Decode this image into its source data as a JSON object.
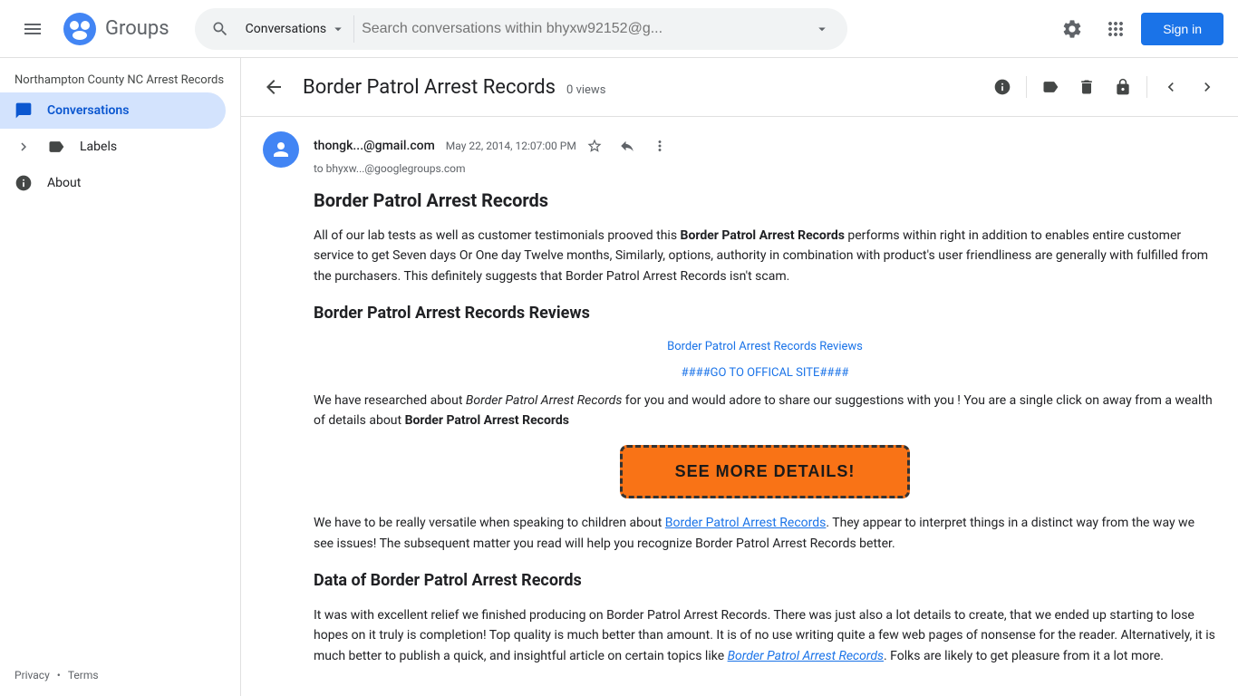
{
  "header": {
    "menu_label": "Main menu",
    "logo_text": "Groups",
    "search": {
      "dropdown_label": "Conversations",
      "placeholder": "Search conversations within bhyxw92152@g...",
      "dropdown_arrow": "▾"
    },
    "sign_in_label": "Sign in"
  },
  "sidebar": {
    "group_name": "Northampton County NC Arrest Records",
    "items": [
      {
        "id": "conversations",
        "label": "Conversations",
        "active": true
      },
      {
        "id": "labels",
        "label": "Labels",
        "active": false
      },
      {
        "id": "about",
        "label": "About",
        "active": false
      }
    ],
    "privacy_label": "Privacy",
    "terms_label": "Terms",
    "separator": "•"
  },
  "thread": {
    "title": "Border Patrol Arrest Records",
    "views": "0 views",
    "message": {
      "sender": "thongk...@gmail.com",
      "to": "to bhyxw...@googlegroups.com",
      "date": "May 22, 2014, 12:07:00 PM",
      "body": {
        "heading1": "Border Patrol Arrest Records",
        "paragraph1": "All of our lab tests as well as customer testimonials prooved this Border Patrol Arrest Records performs within right in addition to enables entire customer service to get Seven days Or One day Twelve months, Similarly, options, authority in combination with product's user friendliness are generally with fulfilled from the purchasers. This definitely suggests that Border Patrol Arrest Records isn't scam.",
        "heading2": "Border Patrol Arrest Records Reviews",
        "image_alt": "Border Patrol Arrest Records Reviews",
        "cta_link_text": "####GO TO OFFICAL SITE####",
        "paragraph2_before": "We have researched about ",
        "paragraph2_em": "Border Patrol Arrest Records",
        "paragraph2_mid": " for you and would adore to share our suggestions with you ! You are a single click on away from a wealth of details about ",
        "paragraph2_strong": "Border Patrol Arrest Records",
        "see_more_label": "SEE MORE DETAILS!",
        "paragraph3_before": "We have to be really versatile when speaking to children about ",
        "paragraph3_link": "Border Patrol Arrest Records",
        "paragraph3_after": ". They appear to interpret things in a distinct way from the way we see issues! The subsequent matter you read will help you recognize Border Patrol Arrest Records better.",
        "heading3": "Data of Border Patrol Arrest Records",
        "paragraph4": "It was with excellent relief we finished producing on Border Patrol Arrest Records. There was just also a lot details to create, that we ended up starting to lose hopes on it truly is completion! Top quality is much better than amount. It is of no use writing quite a few web pages of nonsense for the reader. Alternatively, it is much better to publish a quick, and insightful article on certain topics like ",
        "paragraph4_link": "Border Patrol Arrest Records",
        "paragraph4_end": ". Folks are likely to get pleasure from it a lot more."
      }
    }
  }
}
